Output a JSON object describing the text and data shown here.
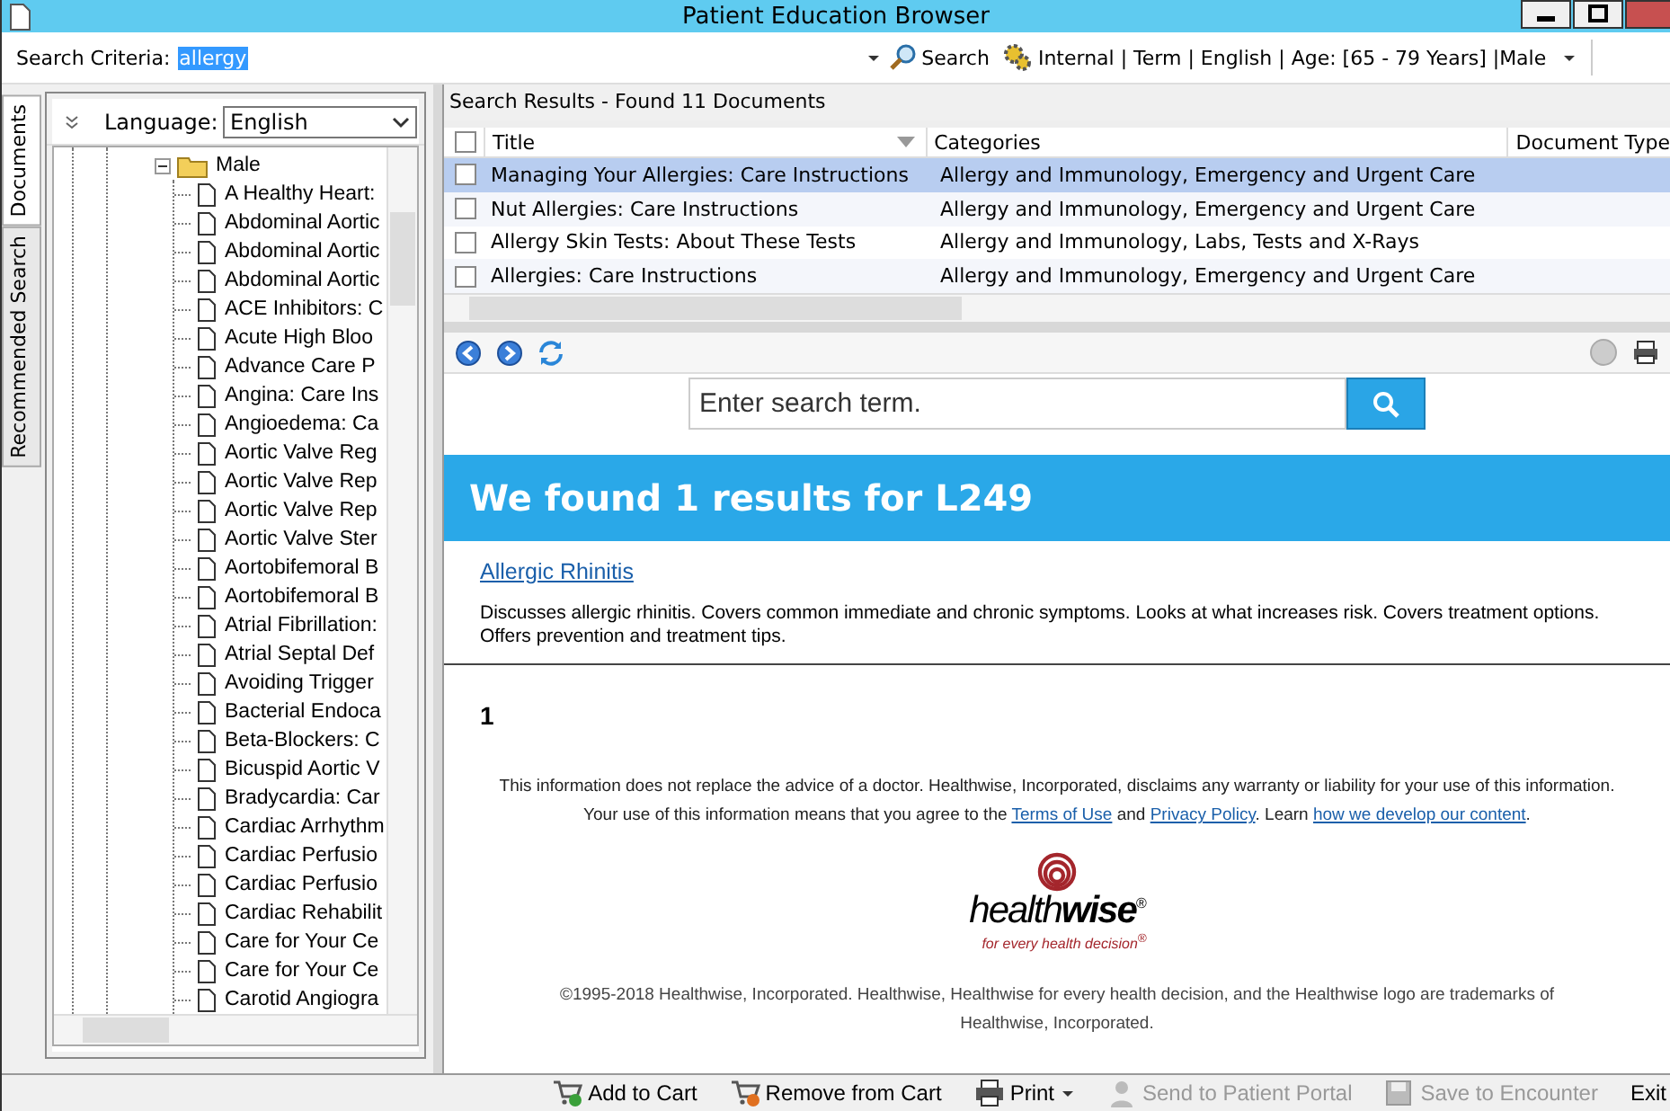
{
  "window": {
    "title": "Patient Education Browser"
  },
  "search": {
    "label": "Search Criteria:",
    "value": "allergy",
    "button": "Search",
    "filter": "Internal | Term | English | Age: [65 - 79 Years] |Male"
  },
  "side_tabs": [
    {
      "label": "Documents",
      "selected": true
    },
    {
      "label": "Recommended Search",
      "selected": false
    }
  ],
  "language": {
    "label": "Language:",
    "value": "English"
  },
  "tree": [
    {
      "label": "Male",
      "expanded": true,
      "children": [
        {
          "label": "A Healthy Heart:"
        },
        {
          "label": "Abdominal Aortic"
        },
        {
          "label": "Abdominal Aortic"
        },
        {
          "label": "Abdominal Aortic"
        },
        {
          "label": "ACE Inhibitors: C"
        },
        {
          "label": "Acute High Bloo"
        },
        {
          "label": "Advance Care P"
        },
        {
          "label": "Angina: Care Ins"
        },
        {
          "label": "Angioedema: Ca"
        },
        {
          "label": "Aortic Valve Reg"
        },
        {
          "label": "Aortic Valve Rep"
        },
        {
          "label": "Aortic Valve Rep"
        },
        {
          "label": "Aortic Valve Ster"
        },
        {
          "label": "Aortobifemoral B"
        },
        {
          "label": "Aortobifemoral B"
        },
        {
          "label": "Atrial Fibrillation:"
        },
        {
          "label": "Atrial Septal Def"
        },
        {
          "label": "Avoiding Trigger"
        },
        {
          "label": "Bacterial Endoca"
        },
        {
          "label": "Beta-Blockers: C"
        },
        {
          "label": "Bicuspid Aortic V"
        },
        {
          "label": "Bradycardia: Car"
        },
        {
          "label": "Cardiac Arrhythm"
        },
        {
          "label": "Cardiac Perfusio"
        },
        {
          "label": "Cardiac Perfusio"
        },
        {
          "label": "Cardiac Rehabilit"
        },
        {
          "label": "Care for Your Ce"
        },
        {
          "label": "Care for Your Ce"
        },
        {
          "label": "Carotid Angiogra"
        }
      ]
    }
  ],
  "results": {
    "header": "Search Results - Found 11 Documents",
    "all_checked": false,
    "columns": [
      "Title",
      "Categories",
      "Document Type"
    ],
    "rows": [
      {
        "title": "Managing Your Allergies: Care Instructions",
        "categories": "Allergy and Immunology, Emergency and Urgent Care",
        "checked": false,
        "selected": true
      },
      {
        "title": "Nut Allergies: Care Instructions",
        "categories": "Allergy and Immunology, Emergency and Urgent Care",
        "checked": false,
        "selected": false
      },
      {
        "title": "Allergy Skin Tests: About These Tests",
        "categories": "Allergy and Immunology, Labs,  Tests and X-Rays",
        "checked": false,
        "selected": false
      },
      {
        "title": "Allergies: Care Instructions",
        "categories": "Allergy and Immunology, Emergency and Urgent Care",
        "checked": false,
        "selected": false
      }
    ]
  },
  "browser": {
    "search_placeholder": "Enter search term.",
    "banner": "We found 1 results for L249",
    "result_link": "Allergic Rhinitis",
    "result_description": "Discusses allergic rhinitis. Covers common immediate and chronic symptoms. Looks at what increases risk. Covers treatment options. Offers prevention and treatment tips.",
    "page_number": "1",
    "disclaimer": [
      {
        "kind": "text",
        "text": "This information does not replace the advice of a doctor. Healthwise, Incorporated, disclaims any warranty or liability for your use of this information. Your use of this information means that you agree to the "
      },
      {
        "kind": "link",
        "text": "Terms of Use"
      },
      {
        "kind": "text",
        "text": " and "
      },
      {
        "kind": "link",
        "text": "Privacy Policy"
      },
      {
        "kind": "text",
        "text": ". Learn "
      },
      {
        "kind": "link",
        "text": "how we develop our content"
      },
      {
        "kind": "text",
        "text": "."
      }
    ],
    "logo": "health**wise**$^{®}$",
    "tagline": "for every health decision$^{®}$",
    "copyright": "©1995-2018 Healthwise, Incorporated. Healthwise, Healthwise for every health decision, and the Healthwise logo are trademarks of Healthwise, Incorporated."
  },
  "toolbar": [
    {
      "label": "Add to Cart",
      "kind": "add",
      "disabled": false
    },
    {
      "label": "Remove from Cart",
      "kind": "remove",
      "disabled": false
    },
    {
      "label": "Print",
      "kind": "print",
      "disabled": false,
      "dropdown": true
    },
    {
      "label": "Send to Patient Portal",
      "kind": "send",
      "disabled": true
    },
    {
      "label": "Save to Encounter",
      "kind": "save",
      "disabled": true
    },
    {
      "label": "Exit",
      "kind": "exit",
      "disabled": false
    }
  ]
}
